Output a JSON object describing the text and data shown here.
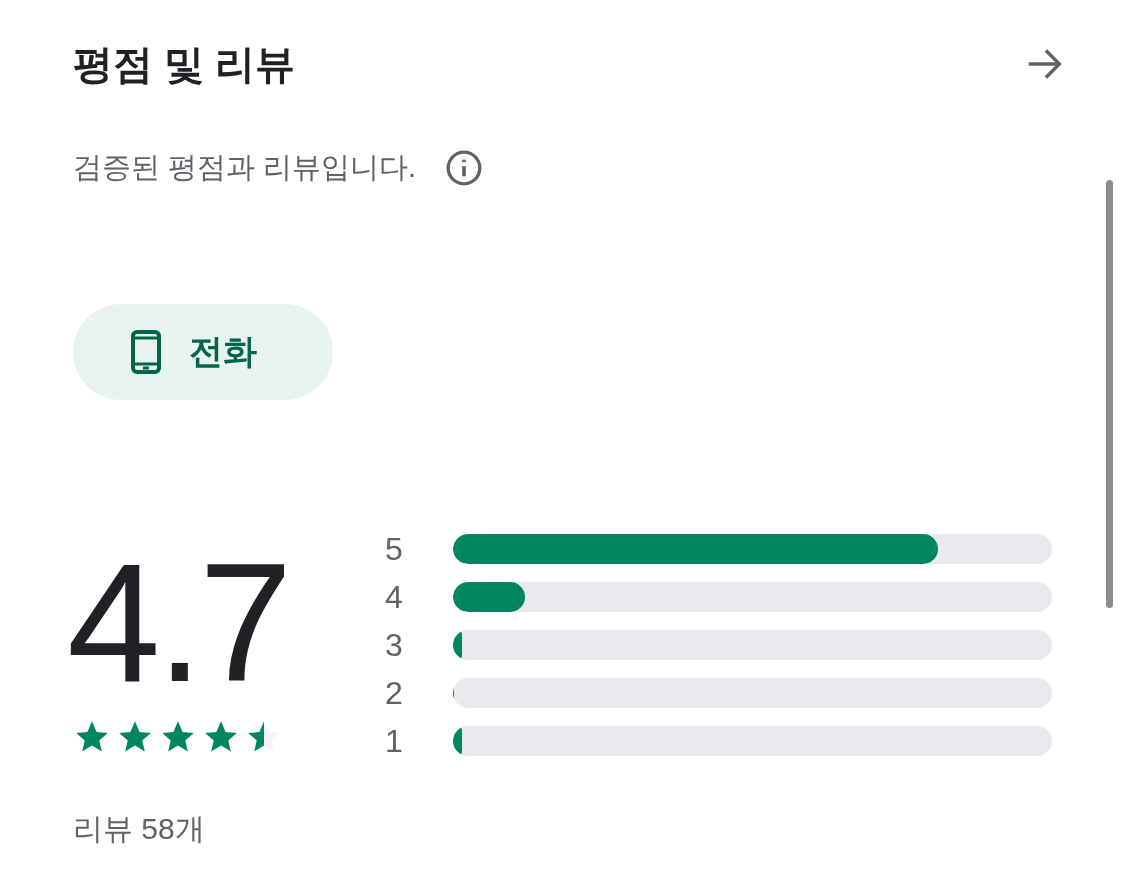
{
  "header": {
    "title": "평점 및 리뷰"
  },
  "subtitle": "검증된 평점과 리뷰입니다.",
  "device_chip": {
    "label": "전화",
    "selected": true
  },
  "summary": {
    "score": "4.7",
    "stars": 4.5,
    "review_count": "리뷰 58개"
  },
  "histogram": [
    {
      "label": "5",
      "level": 0.81
    },
    {
      "label": "4",
      "level": 0.12
    },
    {
      "label": "3",
      "level": 0.015
    },
    {
      "label": "2",
      "level": 0
    },
    {
      "label": "1",
      "level": 0.015
    }
  ]
}
